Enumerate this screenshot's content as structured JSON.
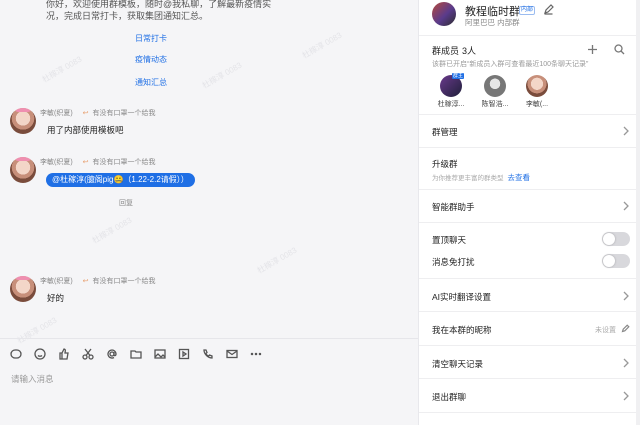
{
  "chat": {
    "top_text": "你好，欢迎使用群模板，随时@我私聊，了解最新疫情实况，完成日常打卡，获取集团通知汇总。",
    "links": [
      "日常打卡",
      "疫情动态",
      "通知汇总"
    ],
    "messages": [
      {
        "sender": "李敏(织夏)",
        "reply_to": "有没有口罩一个给我",
        "text": "用了内部使用模板吧"
      },
      {
        "sender": "李敏(织夏)",
        "reply_to": "有没有口罩一个给我",
        "text": "@杜稼淳(臆阁pig🤐（1.22-2.2请假））"
      },
      {
        "sender": "李敏(织夏)",
        "reply_to": "有没有口罩一个给我",
        "text": "好的"
      }
    ],
    "reply_tag": "回复",
    "watermark": "杜稼淳 0083",
    "input_placeholder": "请输入消息",
    "toolbar_icons": [
      "gif-icon",
      "emoji-icon",
      "thumbs-up-icon",
      "scissors-icon",
      "at-icon",
      "folder-icon",
      "image-icon",
      "video-icon",
      "phone-icon",
      "mail-icon",
      "more-icon"
    ]
  },
  "panel": {
    "group_name": "教程临时群",
    "group_tag": "内部",
    "group_org": "阿里巴巴  内部群",
    "members_title": "群成员",
    "members_count": "3人",
    "members_note": "该群已开启“新成员入群可查看最近100条聊天记录”",
    "members": [
      {
        "name": "杜稼淳...",
        "badge": "群主"
      },
      {
        "name": "陈智浩..."
      },
      {
        "name": "李敏(..."
      }
    ],
    "rows": {
      "manage": "群管理",
      "upgrade": "升级群",
      "upgrade_sub": "为你推荐更丰富的群类型",
      "upgrade_link": "去查看",
      "assistant": "智能群助手",
      "pin": "置顶聊天",
      "mute": "消息免打扰",
      "translate": "AI实时翻译设置",
      "nickname": "我在本群的昵称",
      "nickname_value": "未设置",
      "clear": "清空聊天记录",
      "exit": "退出群聊"
    },
    "toggles": {
      "pin": false,
      "mute": false
    }
  }
}
